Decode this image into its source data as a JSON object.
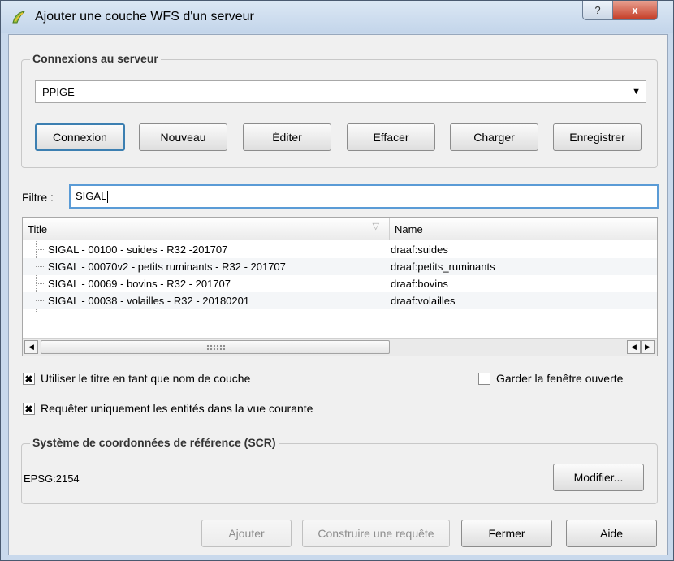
{
  "window": {
    "title": "Ajouter une couche WFS d'un serveur",
    "help_button": "?",
    "close_button": "x"
  },
  "connections": {
    "group_title": "Connexions au serveur",
    "selected_server": "PPIGE",
    "buttons": {
      "connect": "Connexion",
      "new": "Nouveau",
      "edit": "Éditer",
      "delete": "Effacer",
      "load": "Charger",
      "save": "Enregistrer"
    }
  },
  "filter": {
    "label": "Filtre :",
    "value": "SIGAL"
  },
  "layers_table": {
    "columns": [
      "Title",
      "Name"
    ],
    "rows": [
      {
        "title": "SIGAL - 00100 - suides - R32  -201707",
        "name": "draaf:suides"
      },
      {
        "title": "SIGAL - 00070v2 - petits ruminants - R32 - 201707",
        "name": "draaf:petits_ruminants"
      },
      {
        "title": "SIGAL - 00069 - bovins - R32 - 201707",
        "name": "draaf:bovins"
      },
      {
        "title": "SIGAL - 00038 - volailles - R32 - 20180201",
        "name": "draaf:volailles"
      }
    ]
  },
  "options": {
    "use_title_as_name": {
      "label": "Utiliser le titre en tant que nom de couche",
      "checked": true
    },
    "keep_window_open": {
      "label": "Garder la fenêtre ouverte",
      "checked": false
    },
    "only_current_view": {
      "label": "Requêter uniquement les entités dans la vue courante",
      "checked": true
    }
  },
  "crs": {
    "group_title": "Système de coordonnées de référence (SCR)",
    "value": "EPSG:2154",
    "modify_button": "Modifier..."
  },
  "footer": {
    "add": "Ajouter",
    "build_query": "Construire une requête",
    "close": "Fermer",
    "help": "Aide"
  },
  "colors": {
    "accent": "#3c7fb1",
    "close_button": "#c43c26",
    "dialog_bg": "#f0f0f0"
  }
}
